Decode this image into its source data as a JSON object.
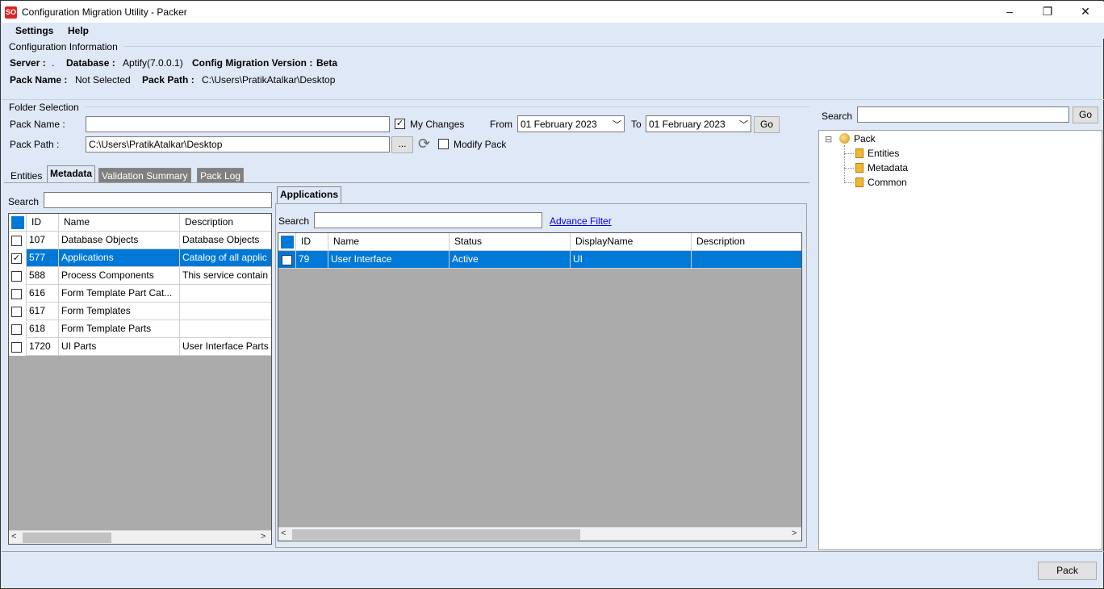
{
  "window": {
    "title": "Configuration Migration Utility - Packer",
    "logo_text": "SO",
    "minimize": "–",
    "restore": "❐",
    "close": "✕"
  },
  "menu": {
    "settings": "Settings",
    "help": "Help"
  },
  "config_info": {
    "section_title": "Configuration Information",
    "server_label": "Server :",
    "server_value": ".",
    "database_label": "Database :",
    "database_value": "Aptify(7.0.0.1)",
    "version_label": "Config Migration Version :",
    "version_value": "Beta",
    "pack_name_label": "Pack Name :",
    "pack_name_value": "Not Selected",
    "pack_path_label": "Pack Path :",
    "pack_path_value": "C:\\Users\\PratikAtalkar\\Desktop"
  },
  "folder_selection": {
    "section_title": "Folder Selection",
    "pack_name_label": "Pack Name :",
    "pack_name_value": "",
    "pack_path_label": "Pack Path :",
    "pack_path_value": "C:\\Users\\PratikAtalkar\\Desktop",
    "browse_label": "...",
    "my_changes_label": "My Changes",
    "my_changes_checked": true,
    "modify_pack_label": "Modify Pack",
    "modify_pack_checked": false,
    "from_label": "From",
    "from_value": "01   February   2023",
    "to_label": "To",
    "to_value": "01   February   2023",
    "go_label": "Go"
  },
  "tabs": {
    "entities": "Entities",
    "metadata": "Metadata",
    "validation_summary": "Validation Summary",
    "pack_log": "Pack Log"
  },
  "left_grid": {
    "search_label": "Search",
    "columns": [
      "ID",
      "Name",
      "Description"
    ],
    "rows": [
      {
        "id": "107",
        "name": "Database Objects",
        "description": "Database Objects",
        "checked": false,
        "selected": false
      },
      {
        "id": "577",
        "name": "Applications",
        "description": "Catalog of all applic",
        "checked": true,
        "selected": true
      },
      {
        "id": "588",
        "name": "Process Components",
        "description": "This service contain",
        "checked": false,
        "selected": false
      },
      {
        "id": "616",
        "name": "Form Template Part Cat...",
        "description": "",
        "checked": false,
        "selected": false
      },
      {
        "id": "617",
        "name": "Form Templates",
        "description": "",
        "checked": false,
        "selected": false
      },
      {
        "id": "618",
        "name": "Form Template Parts",
        "description": "",
        "checked": false,
        "selected": false
      },
      {
        "id": "1720",
        "name": "UI Parts",
        "description": "User Interface Parts",
        "checked": false,
        "selected": false
      }
    ]
  },
  "right_grid": {
    "tab_label": "Applications",
    "search_label": "Search",
    "advance_filter": "Advance Filter",
    "columns": [
      "ID",
      "Name",
      "Status",
      "DisplayName",
      "Description"
    ],
    "rows": [
      {
        "id": "79",
        "name": "User Interface",
        "status": "Active",
        "display_name": "UI",
        "description": "",
        "checked": false,
        "selected": true
      }
    ]
  },
  "tree_panel": {
    "search_label": "Search",
    "go_label": "Go",
    "root": "Pack",
    "children": [
      "Entities",
      "Metadata",
      "Common"
    ],
    "expander": "⊟"
  },
  "footer": {
    "pack_button": "Pack"
  },
  "colors": {
    "background": "#dfe8f6",
    "selection": "#0078d7",
    "grid_empty": "#ababab"
  }
}
